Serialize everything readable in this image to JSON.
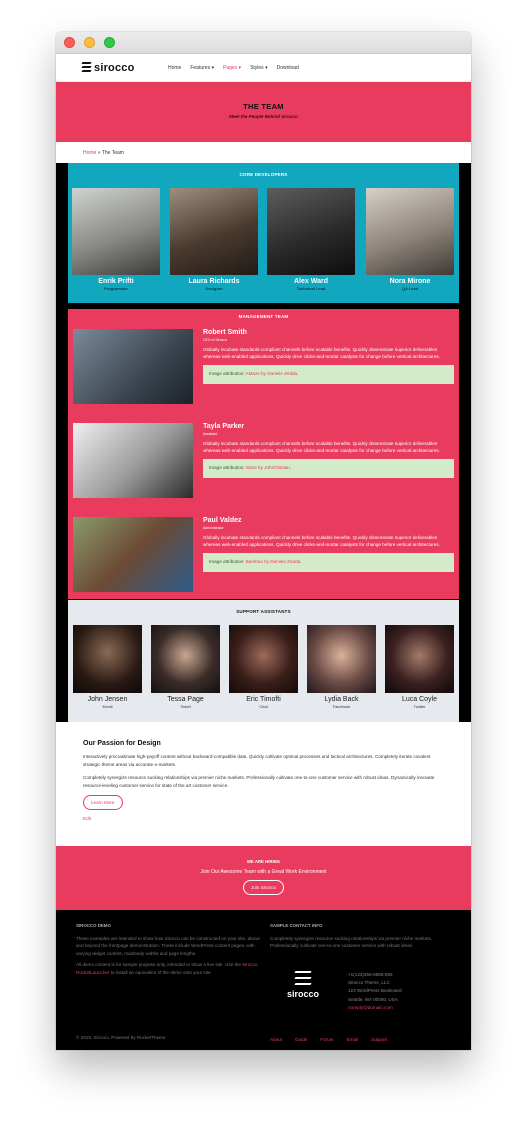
{
  "nav": {
    "logo": "sirocco",
    "items": [
      {
        "label": "Home",
        "active": false
      },
      {
        "label": "Features ▾",
        "active": false
      },
      {
        "label": "Pages ▾",
        "active": true
      },
      {
        "label": "Styles ▾",
        "active": false
      },
      {
        "label": "Download",
        "active": false
      }
    ]
  },
  "hero": {
    "title": "THE TEAM",
    "subtitle": "Meet the People Behind Sirocco"
  },
  "breadcrumb": {
    "home": "Home",
    "sep": "»",
    "current": "The Team"
  },
  "core": {
    "title": "CORE DEVELOPERS",
    "members": [
      {
        "name": "Enrik Prifti",
        "role": "Programmer"
      },
      {
        "name": "Laura Richards",
        "role": "Designer"
      },
      {
        "name": "Alex Ward",
        "role": "Technical Lead"
      },
      {
        "name": "Nora Mirone",
        "role": "QA Lead"
      }
    ]
  },
  "management": {
    "title": "MANAGEMENT TEAM",
    "members": [
      {
        "name": "Robert Smith",
        "role": "CEO of Sirocco",
        "bio": "Globally incubate standards compliant channels before scalable benefits. Quickly disseminate superior deliverables whereas web-enabled applications. Quickly drive clicks-and-mortar catalysts for change before vertical architectures.",
        "attr_prefix": "Image attribution: ",
        "attr_link": "AMaze by Daniele Zedda",
        "attr_suffix": "."
      },
      {
        "name": "Tayla Parker",
        "role": "Assistant",
        "bio": "Globally incubate standards compliant channels before scalable benefits. Quickly disseminate superior deliverables whereas web-enabled applications. Quickly drive clicks-and-mortar catalysts for change before vertical architectures.",
        "attr_prefix": "Image attribution: ",
        "attr_link": "Stare by JohnONolan",
        "attr_suffix": "."
      },
      {
        "name": "Paul Valdez",
        "role": "Administrator",
        "bio": "Globally incubate standards compliant channels before scalable benefits. Quickly disseminate superior deliverables whereas web-enabled applications. Quickly drive clicks-and-mortar catalysts for change before vertical architectures.",
        "attr_prefix": "Image attribution: ",
        "attr_link": "Bamboo by Daniele Zedda",
        "attr_suffix": "."
      }
    ]
  },
  "support": {
    "title": "SUPPORT ASSISTANTS",
    "members": [
      {
        "name": "John Jensen",
        "role": "Email"
      },
      {
        "name": "Tessa Page",
        "role": "Ticket"
      },
      {
        "name": "Eric Timofti",
        "role": "Chat"
      },
      {
        "name": "Lydia Back",
        "role": "Facebook"
      },
      {
        "name": "Luca Coyle",
        "role": "Twitter"
      }
    ]
  },
  "passion": {
    "title": "Our Passion for Design",
    "p1": "Interactively procrastinate high-payoff content without backward-compatible data. Quickly cultivate optimal processes and tactical architectures. Completely iterate covalent strategic theme areas via accurate e-markets.",
    "p2": "Completely synergize resource sucking relationships via premier niche markets. Professionally cultivate one-to-one customer service with robust ideas. Dynamically innovate resource-leveling customer service for state of the art customer service.",
    "button": "Learn More",
    "edit": "Edit"
  },
  "hiring": {
    "title": "WE ARE HIRING",
    "subtitle": "Join Our Awesome Team with a Great Work Environment",
    "button": "Join Sirocco"
  },
  "footer": {
    "demo_title": "SIROCCO DEMO",
    "demo_p1": "These examples are intended to show how Sirocco can be constructed on your site, above and beyond the frontpage demonstration. These include WordPress content pages, with varying widget content, mainbody widths and page lengths.",
    "demo_p2_a": "All demo content is for sample purpose only, intended to show a live site. Use the ",
    "demo_p2_link": "Sirocco RocketLauncher",
    "demo_p2_b": " to install an equivalent of the demo onto your site.",
    "contact_title": "SAMPLE CONTACT INFO",
    "contact_p": "Completely synergize resource sucking relationships via premier niche markets. Professionally cultivate one-to-one customer service with robust ideas.",
    "logo": "sirocco",
    "phone": "+1(123)456-5555-555",
    "company": "Sirocco Theme, LLC",
    "street": "123 WordPress Boulevard",
    "city": "Seattle, WA 00000, USA",
    "email": "noreply@domain.com",
    "copyright": "© 2015, Sirocco. Powered by RocketTheme",
    "links": [
      "About",
      "Guide",
      "Forum",
      "Email",
      "Support"
    ]
  }
}
